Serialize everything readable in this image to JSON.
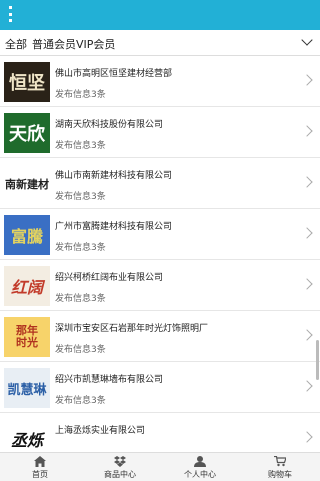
{
  "header": {
    "menu_icon": "vertical-dots-icon"
  },
  "tabs": {
    "all": "全部",
    "members": "普通会员VIP会员"
  },
  "companies": [
    {
      "logo_text": "恒坚",
      "name": "佛山市高明区恒坚建材经营部",
      "count": "发布信息3条"
    },
    {
      "logo_text": "天欣",
      "name": "湖南天欣科技股份有限公司",
      "count": "发布信息3条"
    },
    {
      "logo_text": "南新建材",
      "name": "佛山市南新建材科技有限公司",
      "count": "发布信息3条"
    },
    {
      "logo_text": "富騰",
      "name": "广州市富腾建材科技有限公司",
      "count": "发布信息3条"
    },
    {
      "logo_text": "红阔",
      "name": "绍兴柯桥红阔布业有限公司",
      "count": "发布信息3条"
    },
    {
      "logo_text": "那年时光",
      "name": "深圳市宝安区石岩那年时光灯饰照明厂",
      "count": "发布信息3条"
    },
    {
      "logo_text": "凯慧琳",
      "name": "绍兴市凯慧琳墙布有限公司",
      "count": "发布信息3条"
    },
    {
      "logo_text": "丞烁",
      "name": "上海丞烁实业有限公司",
      "count": ""
    }
  ],
  "footer": {
    "home": "首页",
    "products": "商品中心",
    "profile": "个人中心",
    "cart": "购物车"
  },
  "colors": {
    "accent": "#22b0d6"
  }
}
